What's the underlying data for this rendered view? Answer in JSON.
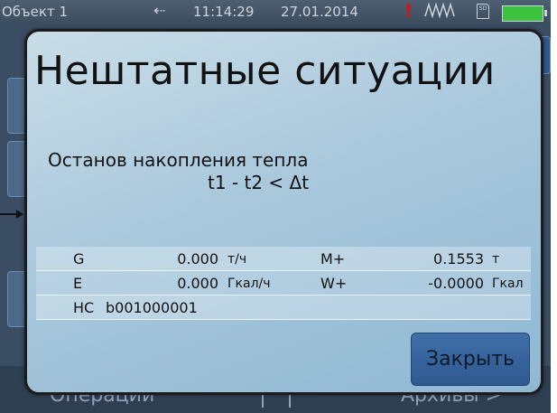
{
  "statusbar": {
    "object_label": "Объект 1",
    "usb_icon": "usb-icon",
    "time": "11:14:29",
    "date": "27.01.2014",
    "alarm_icon": "!",
    "wave_icon": "pulse-wave-icon",
    "sd_icon": "SD",
    "battery_icon": "battery-icon",
    "battery_color": "#3cc23c",
    "alarm_color": "#e01010"
  },
  "background": {
    "bottom_left_label": "Операции",
    "bottom_right_label": "Архивы >"
  },
  "dialog": {
    "title": "Нештатные ситуации",
    "message_line1": "Останов накопления тепла",
    "message_line2": "t1 - t2 < Δt",
    "rows": [
      {
        "k1": "G",
        "v1": "0.000",
        "u1": "т/ч",
        "k2": "M+",
        "v2": "0.1553",
        "u2": "т"
      },
      {
        "k1": "E",
        "v1": "0.000",
        "u1": "Гкал/ч",
        "k2": "W+",
        "v2": "-0.0000",
        "u2": "Гкал"
      }
    ],
    "hc_label": "НС",
    "hc_value": "b001000001",
    "close_label": "Закрыть",
    "accent_color": "#2f5890"
  }
}
